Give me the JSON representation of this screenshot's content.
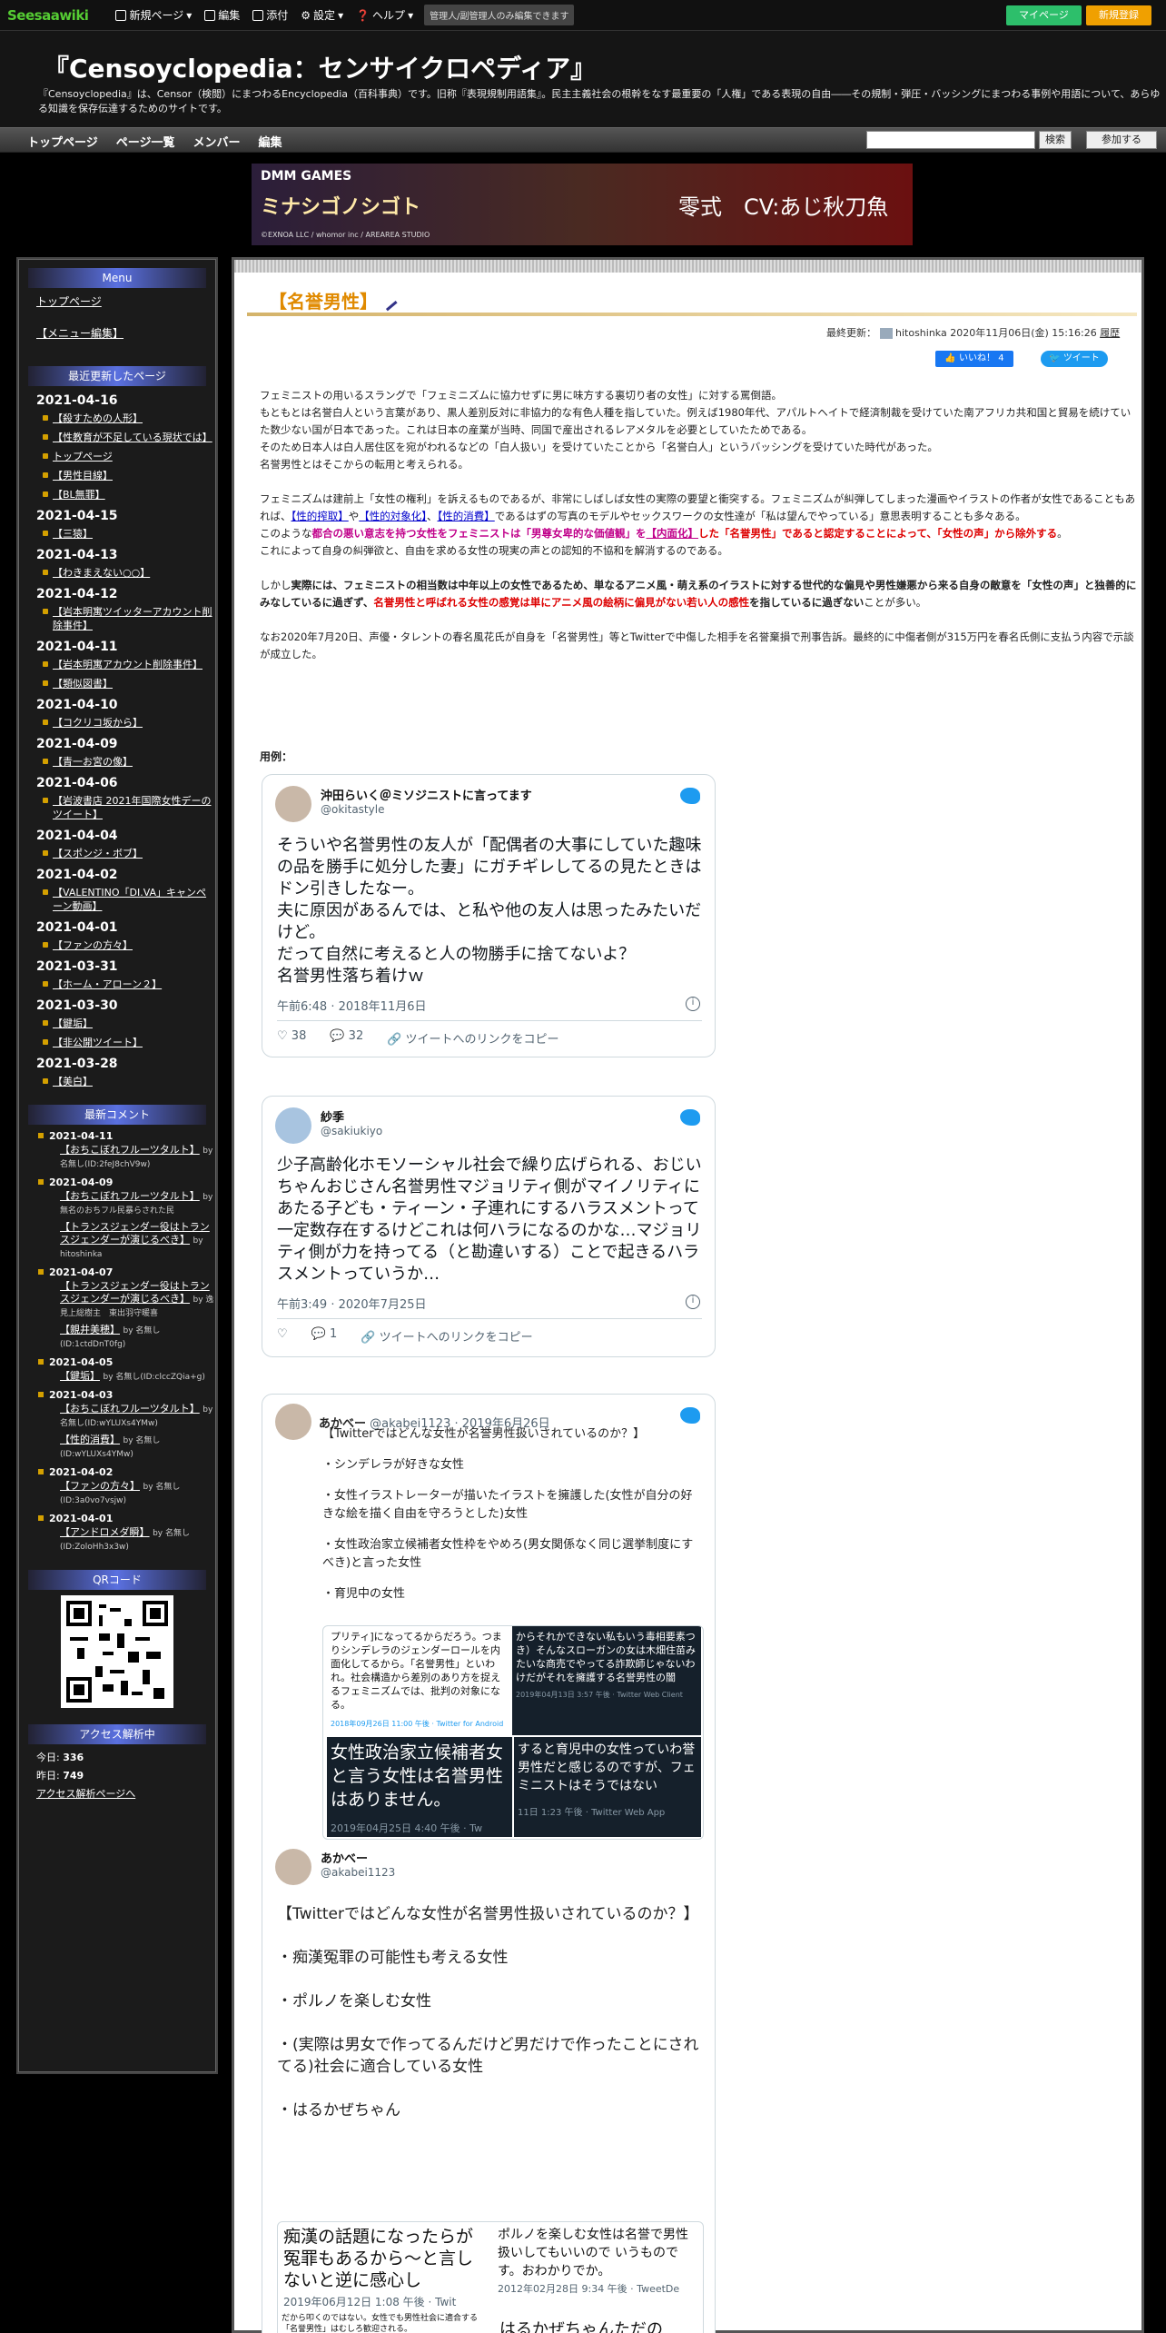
{
  "topbar": {
    "logo": "Seesaa",
    "logo_sub": "wiki",
    "menu": [
      "新規ページ",
      "編集",
      "添付",
      "設定",
      "ヘルプ"
    ],
    "admin_note": "管理人/副管理人のみ編集できます",
    "mypage": "マイページ",
    "register": "新規登録"
  },
  "site": {
    "title": "『Censoyclopedia：センサイクロペディア』",
    "description": "『Censoyclopedia』は、Censor（検閲）にまつわるEncyclopedia（百科事典）です。旧称『表現規制用語集』。民主主義社会の根幹をなす最重要の「人権」である表現の自由――その規制・弾圧・バッシングにまつわる事例や用語について、あらゆる知識を保存伝達するためのサイトです。"
  },
  "nav": {
    "items": [
      "トップページ",
      "ページ一覧",
      "メンバー",
      "編集"
    ],
    "search_btn": "検索",
    "join_btn": "参加する"
  },
  "banner": {
    "brand": "DMM GAMES",
    "game": "ミナシゴノシゴト",
    "right": "零式　CV:あじ秋刀魚",
    "copy": "©EXNOA LLC / whomor inc / AREAREA STUDIO"
  },
  "sidebar": {
    "menu_title": "Menu",
    "menu_links": [
      "トップページ",
      "【メニュー編集】"
    ],
    "recent_title": "最近更新したページ",
    "recent": [
      {
        "date": "2021-04-16",
        "items": [
          "【殺すための人形】",
          "【性教育が不足している現状では】",
          "トップページ",
          "【男性目線】",
          "【BL無罪】"
        ]
      },
      {
        "date": "2021-04-15",
        "items": [
          "【三猿】"
        ]
      },
      {
        "date": "2021-04-13",
        "items": [
          "【わきまえない○○】"
        ]
      },
      {
        "date": "2021-04-12",
        "items": [
          "【岩本明寓ツイッターアカウント削除事件】"
        ]
      },
      {
        "date": "2021-04-11",
        "items": [
          "【岩本明寓アカウント削除事件】",
          "【類似図書】"
        ]
      },
      {
        "date": "2021-04-10",
        "items": [
          "【コクリコ坂から】"
        ]
      },
      {
        "date": "2021-04-09",
        "items": [
          "【青一お宮の像】"
        ]
      },
      {
        "date": "2021-04-06",
        "items": [
          "【岩波書店 2021年国際女性デーのツイート】"
        ]
      },
      {
        "date": "2021-04-04",
        "items": [
          "【スポンジ・ボブ】"
        ]
      },
      {
        "date": "2021-04-02",
        "items": [
          "【VALENTINO「DI.VA」キャンペーン動画】"
        ]
      },
      {
        "date": "2021-04-01",
        "items": [
          "【ファンの方々】"
        ]
      },
      {
        "date": "2021-03-31",
        "items": [
          "【ホーム・アローン２】"
        ]
      },
      {
        "date": "2021-03-30",
        "items": [
          "【鍵垢】",
          "【非公開ツイート】"
        ]
      },
      {
        "date": "2021-03-28",
        "items": [
          "【美白】"
        ]
      }
    ],
    "comment_title": "最新コメント",
    "comments": [
      {
        "date": "2021-04-11",
        "items": [
          {
            "t": "【おちこぼれフルーツタルト】",
            "by": "by 名無し(ID:2feJ8chV9w)"
          }
        ]
      },
      {
        "date": "2021-04-09",
        "items": [
          {
            "t": "【おちこぼれフルーツタルト】",
            "by": "by 無名のおちフル民暴らされた民"
          },
          {
            "t": "【トランスジェンダー役はトランスジェンダーが演じるべき】",
            "by": "by hitoshinka"
          }
        ]
      },
      {
        "date": "2021-04-07",
        "items": [
          {
            "t": "【トランスジェンダー役はトランスジェンダーが演じるべき】",
            "by": "by 逸見上総樹主　東出羽守暖喜"
          },
          {
            "t": "【親井美穂】",
            "by": "by 名無し(ID:1ctdDnT0fg)"
          }
        ]
      },
      {
        "date": "2021-04-05",
        "items": [
          {
            "t": "【鍵垢】",
            "by": "by 名無し(ID:clccZQia+g)"
          }
        ]
      },
      {
        "date": "2021-04-03",
        "items": [
          {
            "t": "【おちこぼれフルーツタルト】",
            "by": "by 名無し(ID:wYLUXs4YMw)"
          },
          {
            "t": "【性的消費】",
            "by": "by 名無し(ID:wYLUXs4YMw)"
          }
        ]
      },
      {
        "date": "2021-04-02",
        "items": [
          {
            "t": "【ファンの方々】",
            "by": "by 名無し(ID:3a0vo7vsjw)"
          }
        ]
      },
      {
        "date": "2021-04-01",
        "items": [
          {
            "t": "【アンドロメダ瞬】",
            "by": "by 名無し(ID:ZoloHh3x3w)"
          }
        ]
      }
    ],
    "qr_title": "QRコード",
    "access_title": "アクセス解析中",
    "today_label": "今日:",
    "today": "336",
    "yesterday_label": "昨日:",
    "yesterday": "749",
    "access_link": "アクセス解析ページへ"
  },
  "page": {
    "title": "【名誉男性】",
    "updated": "最終更新：",
    "updated_by": "hitoshinka 2020年11月06日(金) 15:16:26",
    "history": "履歴",
    "like": "いいね！ 4",
    "tweet_btn": "ツイート",
    "p1": "フェミニストの用いるスラングで「フェミニズムに協力せずに男に味方する裏切り者の女性」に対する罵倒語。",
    "p2": "もともとは名誉白人という言葉があり、黒人差別反対に非協力的な有色人種を指していた。例えば1980年代、アパルトヘイトで経済制裁を受けていた南アフリカ共和国と貿易を続けていた数少ない国が日本であった。これは日本の産業が当時、同国で産出されるレアメタルを必要としていたためである。",
    "p3": "そのため日本人は白人居住区を宛がわれるなどの「白人扱い」を受けていたことから「名誉白人」というバッシングを受けていた時代があった。",
    "p4": "名誉男性とはそこからの転用と考えられる。",
    "p5a": "フェミニズムは建前上「女性の権利」を訴えるものであるが、非常にしばしば女性の実際の要望と衝突する。フェミニズムが糾弾してしまった漫画やイラストの作者が女性であることもあれば、",
    "link1": "【性的搾取】",
    "link2": "【性的対象化】",
    "link3": "【性的消費】",
    "p5b": "であるはずの写真のモデルやセックスワークの女性達が「私は望んでやっている」意思表明することも多々ある。",
    "p6a": "このような",
    "p6red": "都合の悪い意志を持つ女性をフェミニストは「男尊女卑的な価値観」を",
    "link4": "【内面化】",
    "p6red2": "した「名誉男性」であると認定することによって、「女性の声」から除外する",
    "p6b": "。",
    "p7": "これによって自身の糾弾欲と、自由を求める女性の現実の声との認知的不協和を解消するのである。",
    "p8a": "しかし",
    "p8b": "実際には、フェミニストの相当数は中年以上の女性であるため、単なるアニメ風・萌え系のイラストに対する世代的な偏見や男性嫌悪から来る自身の敵意を「女性の声」と独善的にみなしているに過ぎず、",
    "p8red": "名誉男性と呼ばれる女性の感覚は単にアニメ風の絵柄に偏見がない若い人の感性",
    "p8c": "を指しているに過ぎない",
    "p8d": "ことが多い。",
    "p9": "なお2020年7月20日、声優・タレントの春名風花氏が自身を「名誉男性」等とTwitterで中傷した相手を名誉棄損で刑事告訴。最終的に中傷者側が315万円を春名氏側に支払う内容で示談が成立した。",
    "examples_label": "用例："
  },
  "tweets": [
    {
      "name": "沖田らいく＠ミソジニストに言ってます",
      "handle": "@okitastyle",
      "text": "そういや名誉男性の友人が「配偶者の大事にしていた趣味の品を勝手に処分した妻」にガチギレしてるの見たときはドン引きしたなー。\n夫に原因があるんでは、と私や他の友人は思ったみたいだけど。\nだって自然に考えると人の物勝手に捨てないよ？\n名誉男性落ち着けｗ",
      "time": "午前6:48 · 2018年11月6日",
      "likes": "38",
      "replies": "32",
      "copy": "ツイートへのリンクをコピー"
    },
    {
      "name": "紗季",
      "handle": "@sakiukiyo",
      "text": "少子高齢化ホモソーシャル社会で繰り広げられる、おじいちゃんおじさん名誉男性マジョリティ側がマイノリティにあたる子ども・ティーン・子連れにするハラスメントって一定数存在するけどこれは何ハラになるのかな…マジョリティ側が力を持ってる（と勘違いする）ことで起きるハラスメントっていうか…",
      "time": "午前3:49 · 2020年7月25日",
      "likes": "",
      "replies": "1",
      "copy": "ツイートへのリンクをコピー"
    },
    {
      "name": "あかべー",
      "handle": "@akabei1123",
      "date": "2019年6月26日",
      "lines": [
        "【Twitterではどんな女性が名誉男性扱いされているのか？】",
        "・シンデレラが好きな女性",
        "・女性イラストレーターが描いたイラストを擁護した(女性が自分の好きな絵を描く自由を守ろうとした)女性",
        "・女性政治家立候補者女性枠をやめろ(男女関係なく同じ選挙制度にすべき)と言った女性",
        "・育児中の女性"
      ],
      "img1": "プリティ]になってるからだろう。つまりシンデレラのジェンダーロールを内面化してるから。「名誉男性」といわれ。社会構造から差別のあり方を捉えるフェミニズムでは、批判の対象になる。",
      "img1t": "2018年09月26日 11:00 午後 · Twitter for Android",
      "img2": "からそれかできない私もいう毒相要素つき）そんなスローガンの女は木畑住苗みたいな商売でやってる詐欺師じゃないわけだがそれを擁護する名誉男性の闇",
      "img2t": "2019年04月13日 3:57 午後 · Twitter Web Client",
      "img3": "女性政治家立候補者女と言う女性は名誉男性はありません。",
      "img3t": "2019年04月25日 4:40 午後 · Tw",
      "img4": "すると育児中の女性っていわ誉男性だと感じるのですが、フェミニストはそうではない",
      "img4t": "11日 1:23 午後 · Twitter Web App"
    },
    {
      "name": "あかべー",
      "handle": "@akabei1123",
      "lines": [
        "【Twitterではどんな女性が名誉男性扱いされているのか？】",
        "・痴漢冤罪の可能性も考える女性",
        "・ポルノを楽しむ女性",
        "・(実際は男女で作ってるんだけど男だけで作ったことにされてる)社会に適合している女性",
        "・はるかぜちゃん"
      ],
      "img5": "痴漢の話題になったらが冤罪もあるから～と言しないと逆に感心し",
      "img5t": "2019年06月12日 1:08 午後 · Twit",
      "img6": "ポルノを楽しむ女性は名誉で男性扱いしてもいいので いうものです。おわかりでか。",
      "img6t": "2012年02月28日 9:34 午後 · TweetDe",
      "img7": "だから叩くのではない。女性でも男性社会に適合する「名誉男性」はむしろ歓迎される。",
      "img8": "はるかぜちゃんただの"
    }
  ],
  "colors": {
    "accent": "#e08a00",
    "green": "#2dbf6b",
    "orange": "#f0a000",
    "twitter": "#1d9bf0"
  }
}
